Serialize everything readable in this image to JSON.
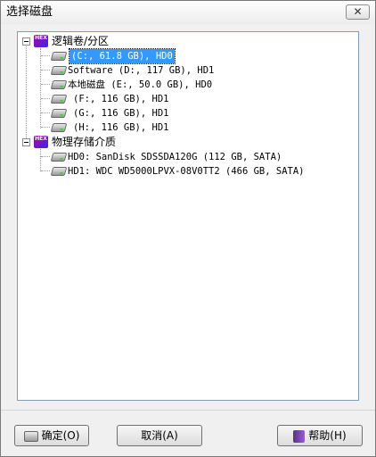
{
  "window": {
    "title": "选择磁盘",
    "close_glyph": "✕"
  },
  "tree": {
    "groups": [
      {
        "label": "逻辑卷/分区",
        "icon": "hex-icon",
        "items": [
          {
            "label": "(C:, 61.8 GB), HD0",
            "selected": true
          },
          {
            "label": "Software (D:, 117 GB), HD1"
          },
          {
            "label": "本地磁盘 (E:, 50.0 GB), HD0"
          },
          {
            "label": "(F:, 116 GB), HD1"
          },
          {
            "label": "(G:, 116 GB), HD1"
          },
          {
            "label": "(H:, 116 GB), HD1"
          }
        ]
      },
      {
        "label": "物理存储介质",
        "icon": "hex-icon",
        "items": [
          {
            "label": "HD0: SanDisk SDSSDA120G (112 GB, SATA)"
          },
          {
            "label": "HD1: WDC WD5000LPVX-08V0TT2 (466 GB, SATA)"
          }
        ]
      }
    ],
    "hex_icon_text": "HEX"
  },
  "buttons": {
    "ok": "确定(O)",
    "cancel": "取消(A)",
    "help": "帮助(H)"
  },
  "colors": {
    "selection": "#3399ff",
    "tree_border": "#7f9db9"
  }
}
